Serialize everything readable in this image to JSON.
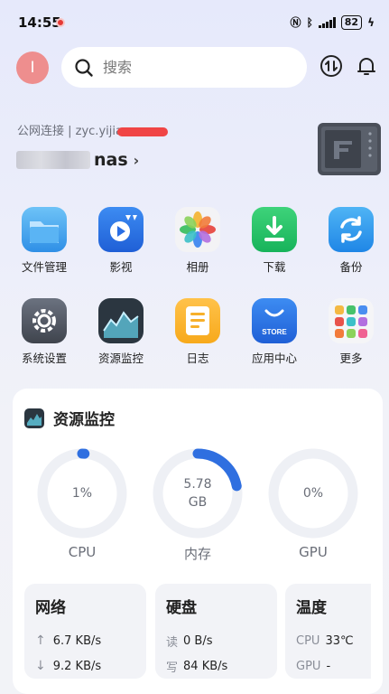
{
  "status_bar": {
    "time": "14:55",
    "battery": "82"
  },
  "header": {
    "avatar_initial": "I",
    "search_placeholder": "搜索"
  },
  "nas": {
    "connection": "公网连接 | zyc.yijia",
    "name_visible": "nas"
  },
  "apps": [
    {
      "label": "文件管理",
      "icon": "folder-icon"
    },
    {
      "label": "影视",
      "icon": "video-icon"
    },
    {
      "label": "相册",
      "icon": "photos-icon"
    },
    {
      "label": "下载",
      "icon": "download-icon"
    },
    {
      "label": "备份",
      "icon": "backup-icon"
    },
    {
      "label": "系统设置",
      "icon": "settings-icon"
    },
    {
      "label": "资源监控",
      "icon": "monitor-icon"
    },
    {
      "label": "日志",
      "icon": "log-icon"
    },
    {
      "label": "应用中心",
      "icon": "store-icon"
    },
    {
      "label": "更多",
      "icon": "more-icon"
    }
  ],
  "store_icon_text": "STORE",
  "monitor": {
    "title": "资源监控",
    "cpu": {
      "label": "CPU",
      "value": "1%",
      "fraction": 0.01
    },
    "memory": {
      "label": "内存",
      "value": "5.78",
      "unit": "GB",
      "fraction": 0.22
    },
    "gpu": {
      "label": "GPU",
      "value": "0%",
      "fraction": 0
    },
    "network": {
      "title": "网络",
      "up": "6.7 KB/s",
      "down": "9.2 KB/s"
    },
    "disk": {
      "title": "硬盘",
      "read_label": "读",
      "read": "0 B/s",
      "write_label": "写",
      "write": "84 KB/s"
    },
    "temp": {
      "title": "温度",
      "cpu_label": "CPU",
      "cpu": "33℃",
      "gpu_label": "GPU",
      "gpu": "-"
    }
  },
  "colors": {
    "accent": "#2f6fe0",
    "ring_track": "#eef0f5"
  }
}
